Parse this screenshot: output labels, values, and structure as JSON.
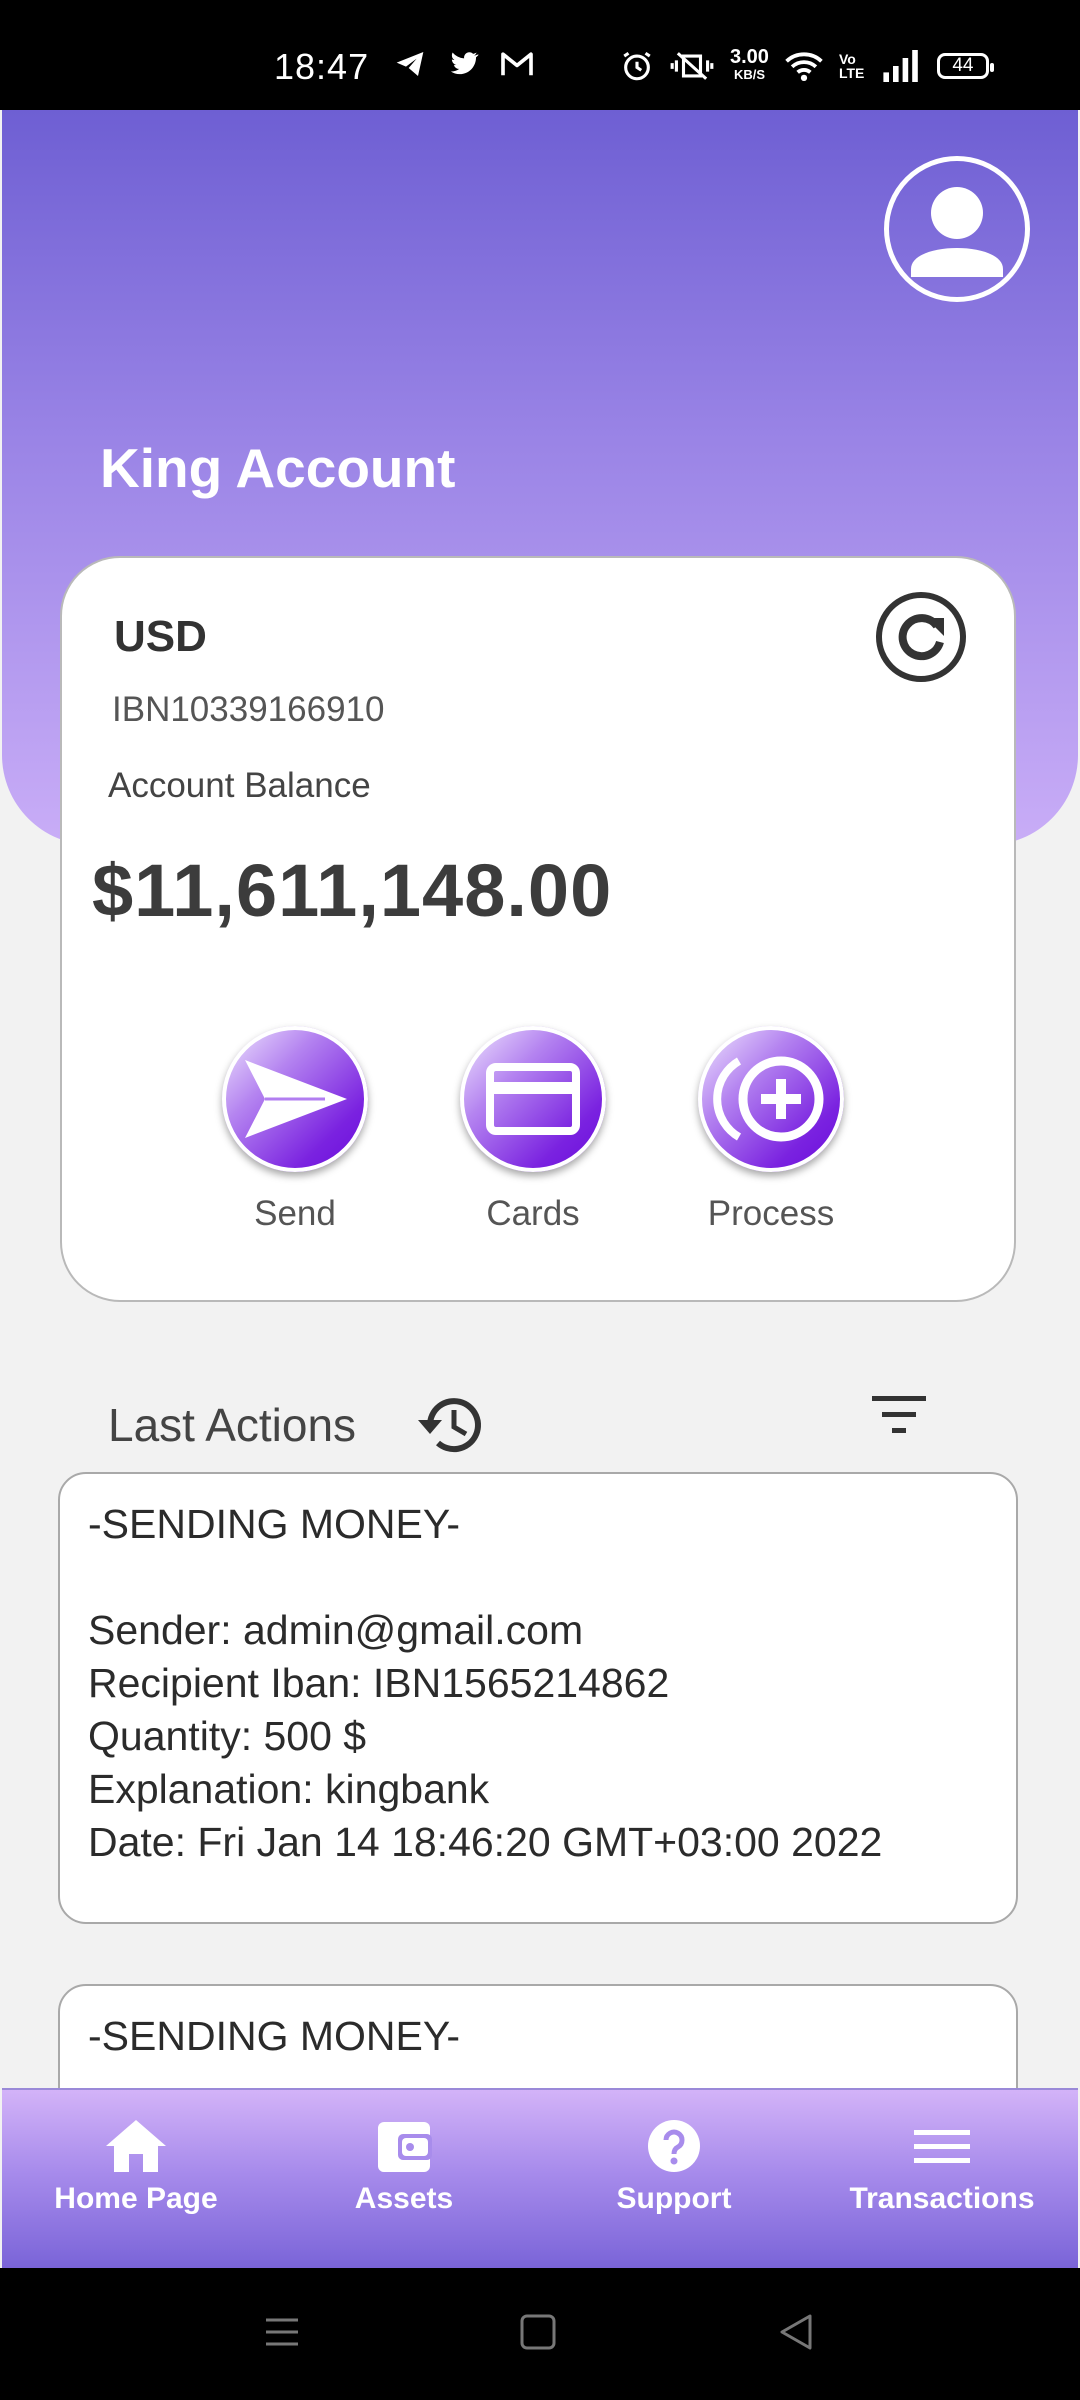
{
  "status_bar": {
    "time": "18:47",
    "net_speed": "3.00",
    "net_unit": "KB/S",
    "volte": "Vo LTE",
    "battery": "44"
  },
  "header": {
    "account_title": "King Account"
  },
  "account_card": {
    "currency": "USD",
    "iban": "IBN10339166910",
    "balance_label": "Account Balance",
    "balance": "$11,611,148.00",
    "actions": [
      {
        "label": "Send",
        "icon": "send-icon"
      },
      {
        "label": "Cards",
        "icon": "card-icon"
      },
      {
        "label": "Process",
        "icon": "add-circle-icon"
      }
    ]
  },
  "last_actions": {
    "title": "Last Actions",
    "items": [
      {
        "type": "-SENDING MONEY-",
        "sender": "Sender: admin@gmail.com",
        "recipient": "Recipient Iban: IBN1565214862",
        "quantity": "Quantity: 500 $",
        "explanation": "Explanation: kingbank",
        "date": "Date: Fri Jan 14 18:46:20 GMT+03:00 2022"
      },
      {
        "type": "-SENDING MONEY-"
      }
    ]
  },
  "bottom_nav": {
    "items": [
      {
        "label": "Home Page",
        "icon": "home-icon"
      },
      {
        "label": "Assets",
        "icon": "wallet-icon"
      },
      {
        "label": "Support",
        "icon": "help-icon"
      },
      {
        "label": "Transactions",
        "icon": "menu-icon"
      }
    ]
  },
  "colors": {
    "header_gradient_top": "#6e5fd3",
    "header_gradient_bottom": "#c9adf7",
    "action_button": "#7a22e0",
    "nav_gradient_top": "#d3b3f8",
    "nav_gradient_bottom": "#7a64d8"
  }
}
